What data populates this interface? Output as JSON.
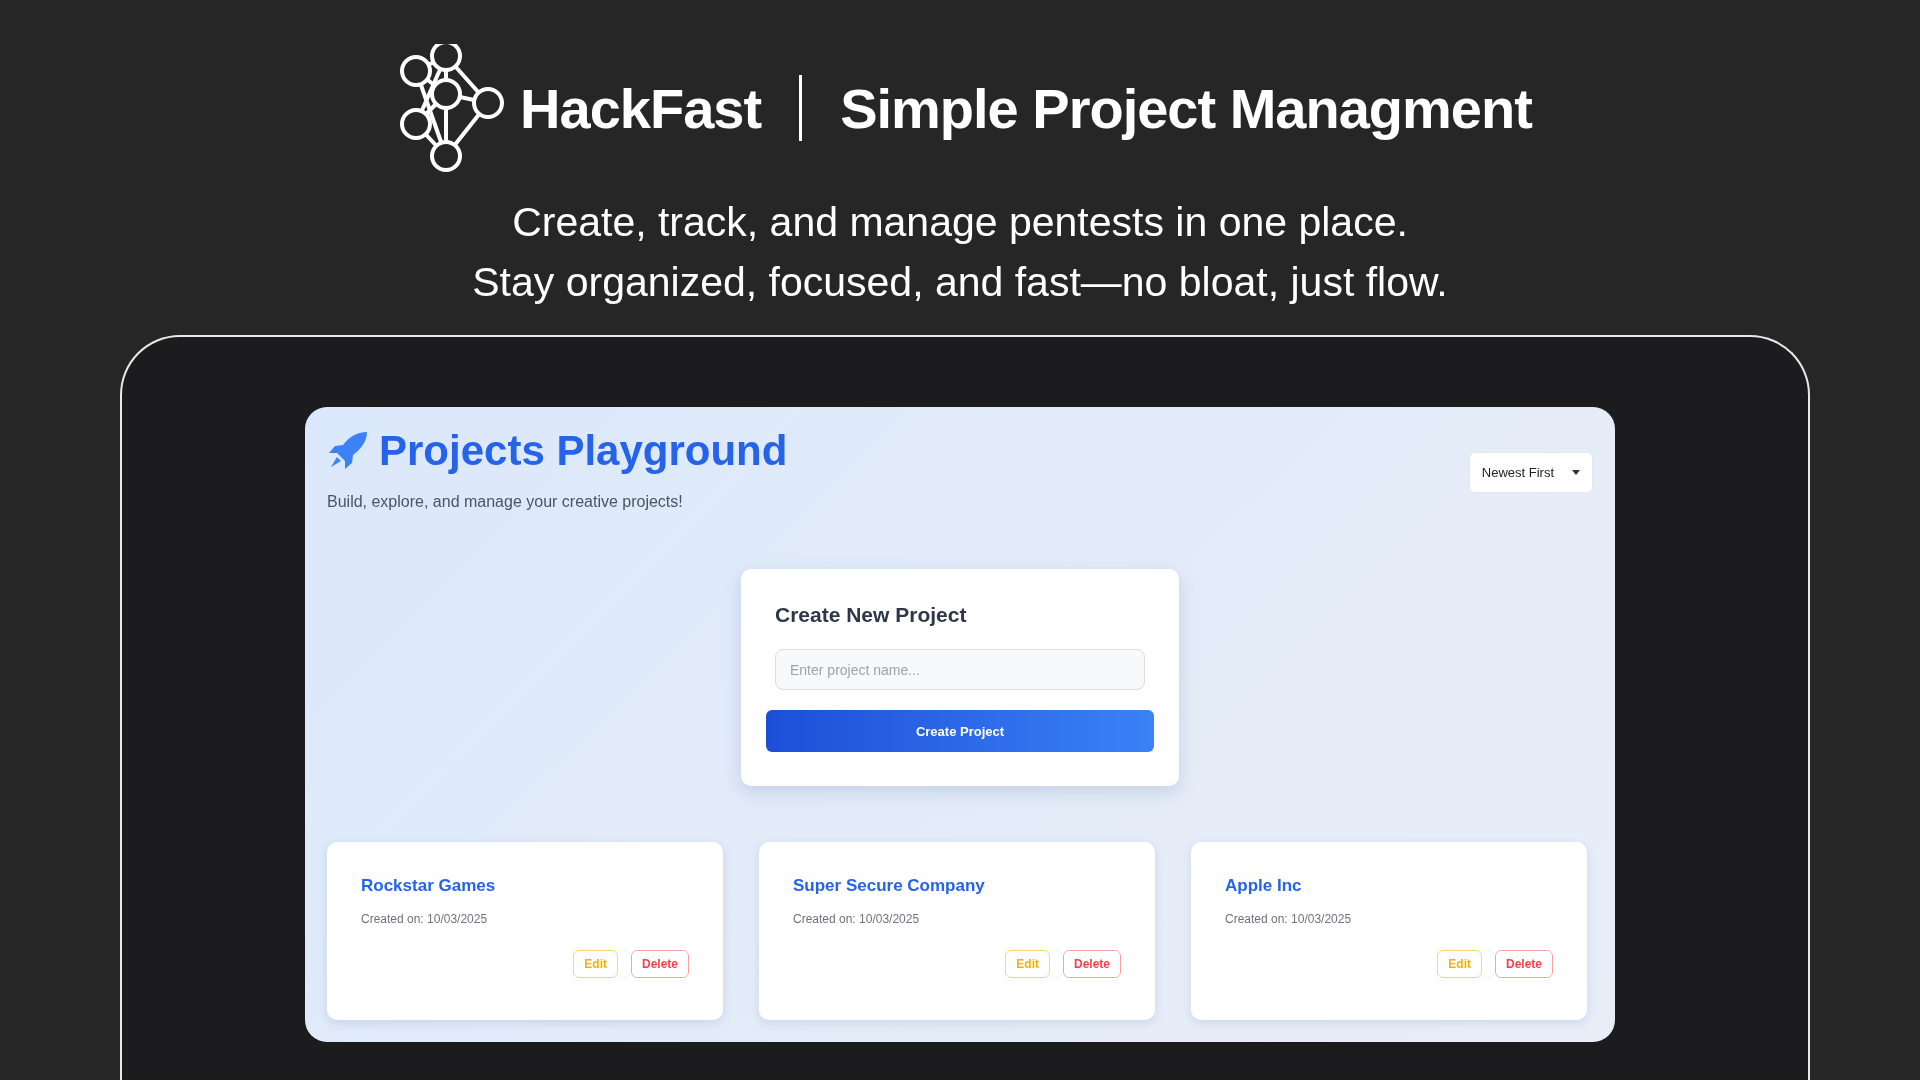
{
  "banner": {
    "brand": "HackFast",
    "title": "Simple Project Managment",
    "tagline": [
      "Create, track, and manage pentests in one place.",
      "Stay organized, focused, and fast—no bloat, just flow."
    ]
  },
  "app": {
    "title": "Projects Playground",
    "subtitle": "Build, explore, and manage your creative projects!",
    "sort": "Newest First",
    "create": {
      "heading": "Create New Project",
      "placeholder": "Enter project name...",
      "button": "Create Project"
    },
    "projects": [
      {
        "name": "Rockstar Games",
        "created": "Created on: 10/03/2025",
        "edit": "Edit",
        "delete": "Delete"
      },
      {
        "name": "Super Secure Company",
        "created": "Created on: 10/03/2025",
        "edit": "Edit",
        "delete": "Delete"
      },
      {
        "name": "Apple Inc",
        "created": "Created on: 10/03/2025",
        "edit": "Edit",
        "delete": "Delete"
      }
    ]
  }
}
